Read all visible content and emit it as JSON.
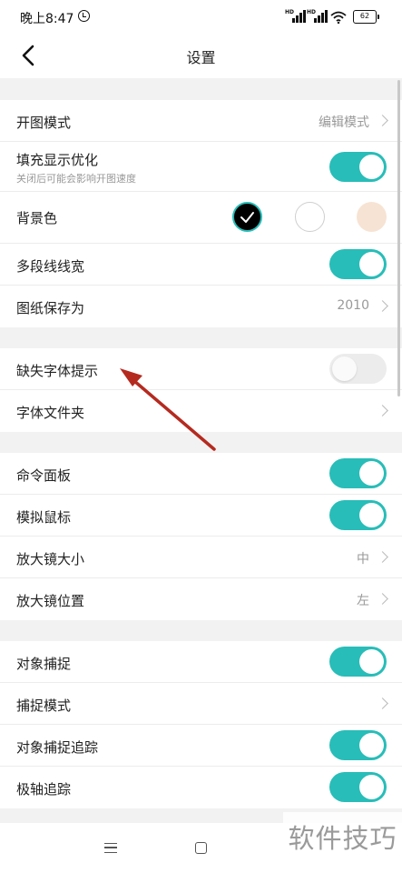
{
  "status_bar": {
    "time": "晚上8:47",
    "battery": "62",
    "network_label": "HD"
  },
  "app_bar": {
    "title": "设置"
  },
  "rows": {
    "open_mode": {
      "label": "开图模式",
      "value": "编辑模式"
    },
    "fill_display": {
      "label": "填充显示优化",
      "sub": "关闭后可能会影响开图速度",
      "toggle_on": true
    },
    "background": {
      "label": "背景色",
      "options": [
        {
          "name": "black",
          "color": "#000000",
          "selected": true
        },
        {
          "name": "white",
          "color": "#ffffff",
          "selected": false
        },
        {
          "name": "beige",
          "color": "#f7e3d3",
          "selected": false
        }
      ]
    },
    "polyline_width": {
      "label": "多段线线宽",
      "toggle_on": true
    },
    "save_as": {
      "label": "图纸保存为",
      "value": "2010"
    },
    "missing_font": {
      "label": "缺失字体提示",
      "toggle_on": false
    },
    "font_folder": {
      "label": "字体文件夹"
    },
    "command_panel": {
      "label": "命令面板",
      "toggle_on": true
    },
    "simulate_mouse": {
      "label": "模拟鼠标",
      "toggle_on": true
    },
    "magnifier_size": {
      "label": "放大镜大小",
      "value": "中"
    },
    "magnifier_position": {
      "label": "放大镜位置",
      "value": "左"
    },
    "object_snap": {
      "label": "对象捕捉",
      "toggle_on": true
    },
    "snap_mode": {
      "label": "捕捉模式"
    },
    "snap_tracking": {
      "label": "对象捕捉追踪",
      "toggle_on": true
    },
    "polar_tracking": {
      "label": "极轴追踪",
      "toggle_on": true
    }
  },
  "watermark": "软件技巧",
  "colors": {
    "accent": "#28bdb8",
    "arrow": "#b52a1f",
    "background": "#f2f2f2"
  }
}
